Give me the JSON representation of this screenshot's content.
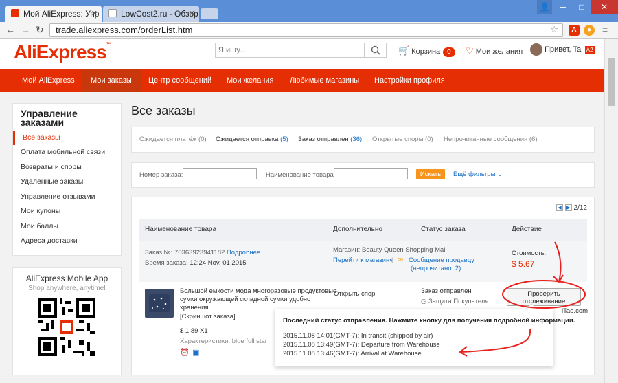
{
  "browser": {
    "tabs": [
      {
        "label": "Мой AliExpress: Упр",
        "active": true,
        "favicon_color": "#e62e04"
      },
      {
        "label": "LowCost2.ru - Обзор",
        "active": false,
        "favicon_color": "#ffffff"
      }
    ],
    "url": "trade.aliexpress.com/orderList.htm"
  },
  "header": {
    "logo": "AliExpress",
    "logo_tm": "™",
    "search_placeholder": "Я ищу...",
    "cart_label": "Корзина",
    "cart_count": "0",
    "wishlist_label": "Мои желания",
    "greeting": "Привет, Tai",
    "user_badge": "A2"
  },
  "nav": {
    "items": [
      "Мой AliExpress",
      "Мои заказы",
      "Центр сообщений",
      "Мои желания",
      "Любимые магазины",
      "Настройки профиля"
    ],
    "active_index": 1
  },
  "sidebar": {
    "title": "Управление заказами",
    "items": [
      "Все заказы",
      "Оплата мобильной связи",
      "Возвраты и споры",
      "Удалённые заказы",
      "Управление отзывами",
      "Мои купоны",
      "Мои баллы",
      "Адреса доставки"
    ],
    "active_index": 0
  },
  "mobile_app": {
    "title": "AliExpress Mobile App",
    "subtitle": "Shop anywhere, anytime!"
  },
  "main": {
    "title": "Все заказы",
    "status_tabs": [
      {
        "label": "Ожидается платёж",
        "count": "(0)"
      },
      {
        "label": "Ожидается отправка",
        "count": "(5)"
      },
      {
        "label": "Заказ отправлен",
        "count": "(36)"
      },
      {
        "label": "Открытые споры",
        "count": "(0)"
      },
      {
        "label": "Непрочитанные сообщения",
        "count": "(6)"
      }
    ],
    "filters": {
      "order_no_label": "Номер заказа:",
      "product_name_label": "Наименование товара:",
      "find_button": "Искать",
      "more_filters": "Ещё фильтры ⌄"
    },
    "pager": "2/12",
    "table_headers": [
      "Наименование товара",
      "Дополнительно",
      "Статус заказа",
      "Действие"
    ],
    "order": {
      "order_no_label": "Заказ №:",
      "order_no": "70363923941182",
      "details_link": "Подробнее",
      "time_label": "Время заказа:",
      "time": "12:24 Nov. 01 2015",
      "store_label": "Магазин:",
      "store": "Beauty Queen Shopping Mall",
      "store_link": "Перейти к магазину",
      "message_link": "Сообщение продавцу",
      "unread": "(непрочитано: 2)",
      "cost_label": "Стоимость:",
      "cost": "$ 5.67"
    },
    "item": {
      "name_line1": "Большой емкости мода многоразовые продуктовые",
      "name_line2": "сумки окружающей складной сумки удобно",
      "name_line3": "хранения",
      "snapshot": "[Скриншот заказа]",
      "price": "$ 1.89 X1",
      "attrs": "Характеристики: blue full star",
      "dispute_link": "Открыть спор",
      "status": "Заказ отправлен",
      "protection": "Защита Покупателя",
      "track_line1": "Проверить",
      "track_line2": "отслеживание",
      "extra_link": "iTao.com"
    },
    "tooltip": {
      "title": "Последний статус отправления. Нажмите кнопку для получения подробной информации.",
      "lines": [
        "2015.11.08 14:01(GMT-7): In transit (shipped by air)",
        "2015.11.08 13:49(GMT-7): Departure from Warehouse",
        "2015.11.08 13:46(GMT-7): Arrival at Warehouse"
      ]
    }
  },
  "colors": {
    "brand": "#e62e04",
    "link": "#1a6fc4",
    "annotation": "#e8211d",
    "find_button": "#f7941d"
  }
}
